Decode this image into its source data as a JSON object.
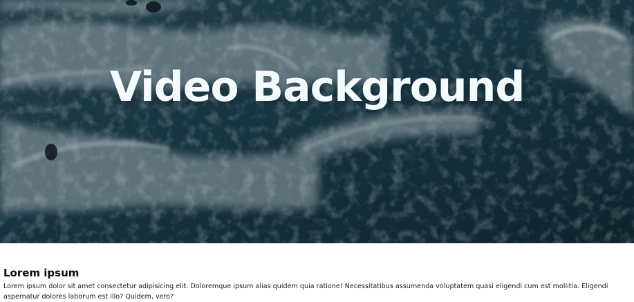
{
  "hero": {
    "title": "Video Background",
    "background": "aerial-ocean-waves-image",
    "colors": {
      "water_dark": "#102c38",
      "water_mid": "#1f4a58",
      "foam": "#e8eef0",
      "title": "#f4fbff"
    }
  },
  "content": {
    "heading": "Lorem ipsum",
    "paragraph": "Lorem ipsum dolor sit amet consectetur adipisicing elit. Doloremque ipsum alias quidem quia ratione! Necessitatibus assumenda voluptatem quasi eligendi cum est mollitia. Eligendi aspernatur dolores laborum est illo? Quidem, vero?"
  }
}
